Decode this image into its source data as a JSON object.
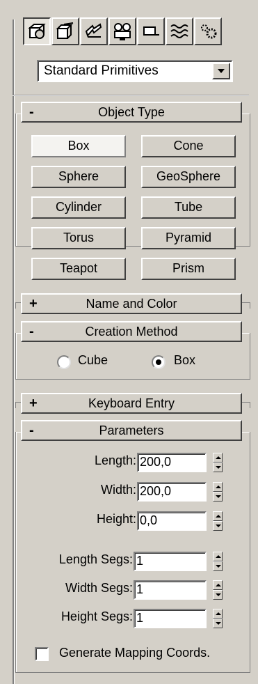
{
  "toolbar": {
    "tabs": [
      {
        "icon": "create-icon",
        "active": true
      },
      {
        "icon": "modify-icon",
        "active": false
      },
      {
        "icon": "hierarchy-icon",
        "active": false
      },
      {
        "icon": "motion-icon",
        "active": false
      },
      {
        "icon": "display-icon",
        "active": false
      },
      {
        "icon": "utilities-icon",
        "active": false
      },
      {
        "icon": "space-warps-icon",
        "active": false
      }
    ]
  },
  "category_dropdown": {
    "selected": "Standard Primitives"
  },
  "object_type": {
    "sign": "-",
    "title": "Object Type",
    "buttons": [
      "Box",
      "Cone",
      "Sphere",
      "GeoSphere",
      "Cylinder",
      "Tube",
      "Torus",
      "Pyramid",
      "Teapot",
      "Prism"
    ],
    "active": "Box"
  },
  "name_and_color": {
    "sign": "+",
    "title": "Name and Color"
  },
  "creation_method": {
    "sign": "-",
    "title": "Creation Method",
    "options": [
      "Cube",
      "Box"
    ],
    "selected": "Box"
  },
  "keyboard_entry": {
    "sign": "+",
    "title": "Keyboard Entry"
  },
  "parameters": {
    "sign": "-",
    "title": "Parameters",
    "length_label": "Length:",
    "length_value": "200,0",
    "width_label": "Width:",
    "width_value": "200,0",
    "height_label": "Height:",
    "height_value": "0,0",
    "length_segs_label": "Length Segs:",
    "length_segs_value": "1",
    "width_segs_label": "Width Segs:",
    "width_segs_value": "1",
    "height_segs_label": "Height Segs:",
    "height_segs_value": "1",
    "mapping_label": "Generate Mapping Coords.",
    "mapping_checked": false
  }
}
